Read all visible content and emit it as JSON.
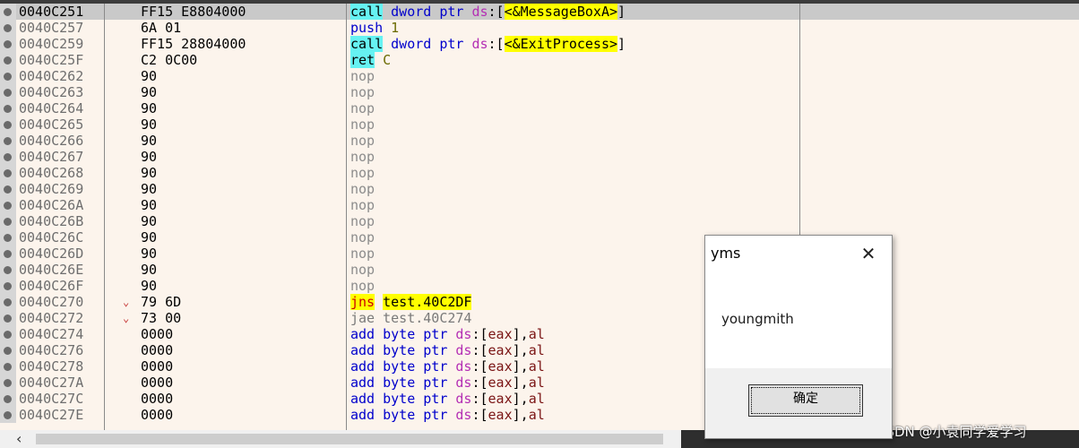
{
  "rows": [
    {
      "addr": "0040C251",
      "bytes": "FF15 E8804000",
      "arrow": "",
      "tokens": [
        {
          "t": "call",
          "c": "hl-call"
        },
        {
          "t": " "
        },
        {
          "t": "dword ptr",
          "c": "t-sym"
        },
        {
          "t": " "
        },
        {
          "t": "ds",
          "c": "t-seg"
        },
        {
          "t": ":[",
          "c": "t-punct"
        },
        {
          "t": "<&MessageBoxA>",
          "c": "hl-lbl"
        },
        {
          "t": "]",
          "c": "t-punct"
        }
      ],
      "selected": true
    },
    {
      "addr": "0040C257",
      "bytes": "6A 01",
      "arrow": "",
      "tokens": [
        {
          "t": "push",
          "c": "t-sym"
        },
        {
          "t": " "
        },
        {
          "t": "1",
          "c": "t-num"
        }
      ]
    },
    {
      "addr": "0040C259",
      "bytes": "FF15 28804000",
      "arrow": "",
      "tokens": [
        {
          "t": "call",
          "c": "hl-call"
        },
        {
          "t": " "
        },
        {
          "t": "dword ptr",
          "c": "t-sym"
        },
        {
          "t": " "
        },
        {
          "t": "ds",
          "c": "t-seg"
        },
        {
          "t": ":[",
          "c": "t-punct"
        },
        {
          "t": "<&ExitProcess>",
          "c": "hl-lbl"
        },
        {
          "t": "]",
          "c": "t-punct"
        }
      ]
    },
    {
      "addr": "0040C25F",
      "bytes": "C2 0C00",
      "arrow": "",
      "tokens": [
        {
          "t": "ret",
          "c": "hl-ret"
        },
        {
          "t": " "
        },
        {
          "t": "C",
          "c": "t-num"
        }
      ]
    },
    {
      "addr": "0040C262",
      "bytes": "90",
      "arrow": "",
      "tokens": [
        {
          "t": "nop",
          "c": "t-nop"
        }
      ]
    },
    {
      "addr": "0040C263",
      "bytes": "90",
      "arrow": "",
      "tokens": [
        {
          "t": "nop",
          "c": "t-nop"
        }
      ]
    },
    {
      "addr": "0040C264",
      "bytes": "90",
      "arrow": "",
      "tokens": [
        {
          "t": "nop",
          "c": "t-nop"
        }
      ]
    },
    {
      "addr": "0040C265",
      "bytes": "90",
      "arrow": "",
      "tokens": [
        {
          "t": "nop",
          "c": "t-nop"
        }
      ]
    },
    {
      "addr": "0040C266",
      "bytes": "90",
      "arrow": "",
      "tokens": [
        {
          "t": "nop",
          "c": "t-nop"
        }
      ]
    },
    {
      "addr": "0040C267",
      "bytes": "90",
      "arrow": "",
      "tokens": [
        {
          "t": "nop",
          "c": "t-nop"
        }
      ]
    },
    {
      "addr": "0040C268",
      "bytes": "90",
      "arrow": "",
      "tokens": [
        {
          "t": "nop",
          "c": "t-nop"
        }
      ]
    },
    {
      "addr": "0040C269",
      "bytes": "90",
      "arrow": "",
      "tokens": [
        {
          "t": "nop",
          "c": "t-nop"
        }
      ]
    },
    {
      "addr": "0040C26A",
      "bytes": "90",
      "arrow": "",
      "tokens": [
        {
          "t": "nop",
          "c": "t-nop"
        }
      ]
    },
    {
      "addr": "0040C26B",
      "bytes": "90",
      "arrow": "",
      "tokens": [
        {
          "t": "nop",
          "c": "t-nop"
        }
      ]
    },
    {
      "addr": "0040C26C",
      "bytes": "90",
      "arrow": "",
      "tokens": [
        {
          "t": "nop",
          "c": "t-nop"
        }
      ]
    },
    {
      "addr": "0040C26D",
      "bytes": "90",
      "arrow": "",
      "tokens": [
        {
          "t": "nop",
          "c": "t-nop"
        }
      ]
    },
    {
      "addr": "0040C26E",
      "bytes": "90",
      "arrow": "",
      "tokens": [
        {
          "t": "nop",
          "c": "t-nop"
        }
      ]
    },
    {
      "addr": "0040C26F",
      "bytes": "90",
      "arrow": "",
      "tokens": [
        {
          "t": "nop",
          "c": "t-nop"
        }
      ]
    },
    {
      "addr": "0040C270",
      "bytes": "79 6D",
      "arrow": "⌄",
      "tokens": [
        {
          "t": "jns",
          "c": "hl-jmp"
        },
        {
          "t": " "
        },
        {
          "t": "test.40C2DF",
          "c": "hl-lbl"
        }
      ]
    },
    {
      "addr": "0040C272",
      "bytes": "73 00",
      "arrow": "⌄",
      "tokens": [
        {
          "t": "jae test.40C274",
          "c": "t-gray"
        }
      ]
    },
    {
      "addr": "0040C274",
      "bytes": "0000",
      "arrow": "",
      "tokens": [
        {
          "t": "add",
          "c": "t-sym"
        },
        {
          "t": " "
        },
        {
          "t": "byte ptr",
          "c": "t-sym"
        },
        {
          "t": " "
        },
        {
          "t": "ds",
          "c": "t-seg"
        },
        {
          "t": ":[",
          "c": "t-punct"
        },
        {
          "t": "eax",
          "c": "t-reg"
        },
        {
          "t": "],",
          "c": "t-punct"
        },
        {
          "t": "al",
          "c": "t-reg"
        }
      ]
    },
    {
      "addr": "0040C276",
      "bytes": "0000",
      "arrow": "",
      "tokens": [
        {
          "t": "add",
          "c": "t-sym"
        },
        {
          "t": " "
        },
        {
          "t": "byte ptr",
          "c": "t-sym"
        },
        {
          "t": " "
        },
        {
          "t": "ds",
          "c": "t-seg"
        },
        {
          "t": ":[",
          "c": "t-punct"
        },
        {
          "t": "eax",
          "c": "t-reg"
        },
        {
          "t": "],",
          "c": "t-punct"
        },
        {
          "t": "al",
          "c": "t-reg"
        }
      ]
    },
    {
      "addr": "0040C278",
      "bytes": "0000",
      "arrow": "",
      "tokens": [
        {
          "t": "add",
          "c": "t-sym"
        },
        {
          "t": " "
        },
        {
          "t": "byte ptr",
          "c": "t-sym"
        },
        {
          "t": " "
        },
        {
          "t": "ds",
          "c": "t-seg"
        },
        {
          "t": ":[",
          "c": "t-punct"
        },
        {
          "t": "eax",
          "c": "t-reg"
        },
        {
          "t": "],",
          "c": "t-punct"
        },
        {
          "t": "al",
          "c": "t-reg"
        }
      ]
    },
    {
      "addr": "0040C27A",
      "bytes": "0000",
      "arrow": "",
      "tokens": [
        {
          "t": "add",
          "c": "t-sym"
        },
        {
          "t": " "
        },
        {
          "t": "byte ptr",
          "c": "t-sym"
        },
        {
          "t": " "
        },
        {
          "t": "ds",
          "c": "t-seg"
        },
        {
          "t": ":[",
          "c": "t-punct"
        },
        {
          "t": "eax",
          "c": "t-reg"
        },
        {
          "t": "],",
          "c": "t-punct"
        },
        {
          "t": "al",
          "c": "t-reg"
        }
      ]
    },
    {
      "addr": "0040C27C",
      "bytes": "0000",
      "arrow": "",
      "tokens": [
        {
          "t": "add",
          "c": "t-sym"
        },
        {
          "t": " "
        },
        {
          "t": "byte ptr",
          "c": "t-sym"
        },
        {
          "t": " "
        },
        {
          "t": "ds",
          "c": "t-seg"
        },
        {
          "t": ":[",
          "c": "t-punct"
        },
        {
          "t": "eax",
          "c": "t-reg"
        },
        {
          "t": "],",
          "c": "t-punct"
        },
        {
          "t": "al",
          "c": "t-reg"
        }
      ]
    },
    {
      "addr": "0040C27E",
      "bytes": "0000",
      "arrow": "",
      "tokens": [
        {
          "t": "add",
          "c": "t-sym"
        },
        {
          "t": " "
        },
        {
          "t": "byte ptr",
          "c": "t-sym"
        },
        {
          "t": " "
        },
        {
          "t": "ds",
          "c": "t-seg"
        },
        {
          "t": ":[",
          "c": "t-punct"
        },
        {
          "t": "eax",
          "c": "t-reg"
        },
        {
          "t": "],",
          "c": "t-punct"
        },
        {
          "t": "al",
          "c": "t-reg"
        }
      ]
    }
  ],
  "dialog": {
    "title": "yms",
    "close_glyph": "✕",
    "message": "youngmith",
    "ok_label": "确定"
  },
  "scrollbar": {
    "left_arrow": "‹"
  },
  "watermark": "CSDN @小袁同学爱学习",
  "colors": {
    "background": "#fcf4ec",
    "call_highlight": "#66f2f2",
    "label_highlight": "#ffff00",
    "segment": "#b42fb4",
    "register": "#7a1414"
  }
}
